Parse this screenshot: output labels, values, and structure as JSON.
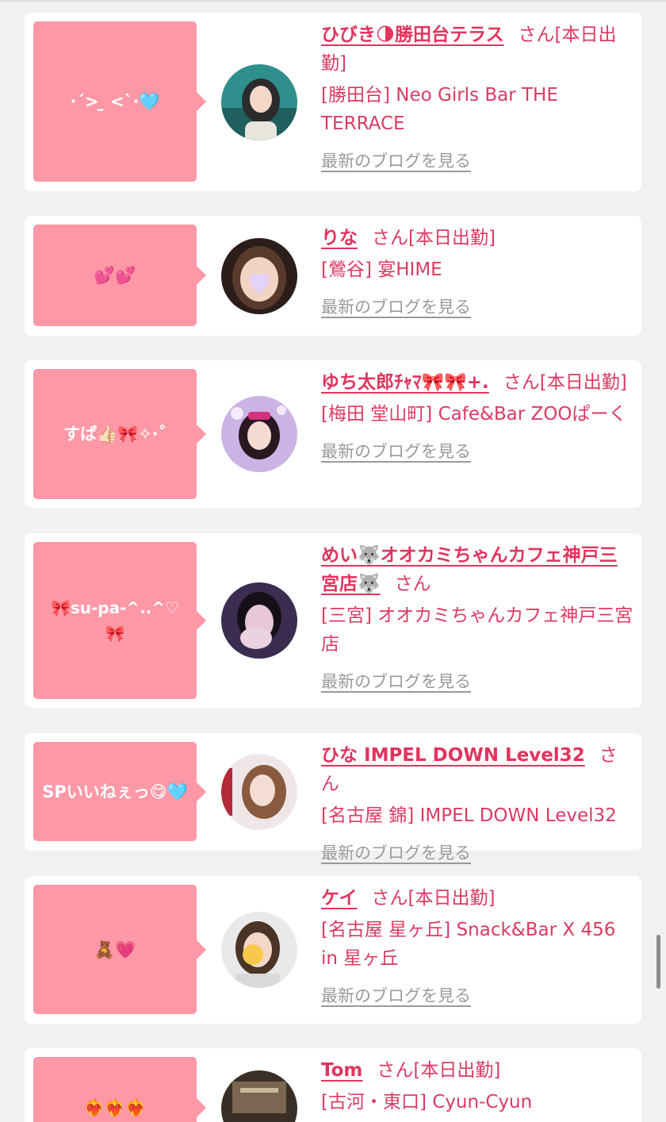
{
  "san_label": "さん",
  "blog_link_label": "最新のブログを見る",
  "entries": [
    {
      "bubble": "·ˊ> ̫ <ˋ·🩵",
      "name": "ひびき🌗勝田台テラス",
      "status": "[本日出勤]",
      "shop": "[勝田台] Neo Girls Bar THE TERRACE"
    },
    {
      "bubble": "💕💕",
      "name": "りな",
      "status": "[本日出勤]",
      "shop": "[鶯谷] 宴HIME"
    },
    {
      "bubble": "すぱ👍🏻🎀✧‧˚",
      "name": "ゆち太郎ﾁｬﾏ🎀🎀+.",
      "status": "[本日出勤]",
      "shop": "[梅田 堂山町] Cafe&Bar ZOOぱーく"
    },
    {
      "bubble": "🎀su-pa-^..^♡🎀",
      "name": "めい🐺オオカミちゃんカフェ神戸三宮店🐺",
      "status": "",
      "shop": "[三宮] オオカミちゃんカフェ神戸三宮店"
    },
    {
      "bubble": "SPいいねぇっ😋🩵",
      "name": "ひな IMPEL DOWN Level32",
      "status": "",
      "shop": "[名古屋 錦] IMPEL DOWN Level32"
    },
    {
      "bubble": "🧸💗",
      "name": "ケイ",
      "status": "[本日出勤]",
      "shop": "[名古屋 星ヶ丘] Snack&Bar X 456 in 星ヶ丘"
    },
    {
      "bubble": "❤️‍🔥❤️‍🔥❤️‍🔥",
      "name": "Tom",
      "status": "[本日出勤]",
      "shop": "[古河・東口] Cyun-Cyun"
    }
  ]
}
